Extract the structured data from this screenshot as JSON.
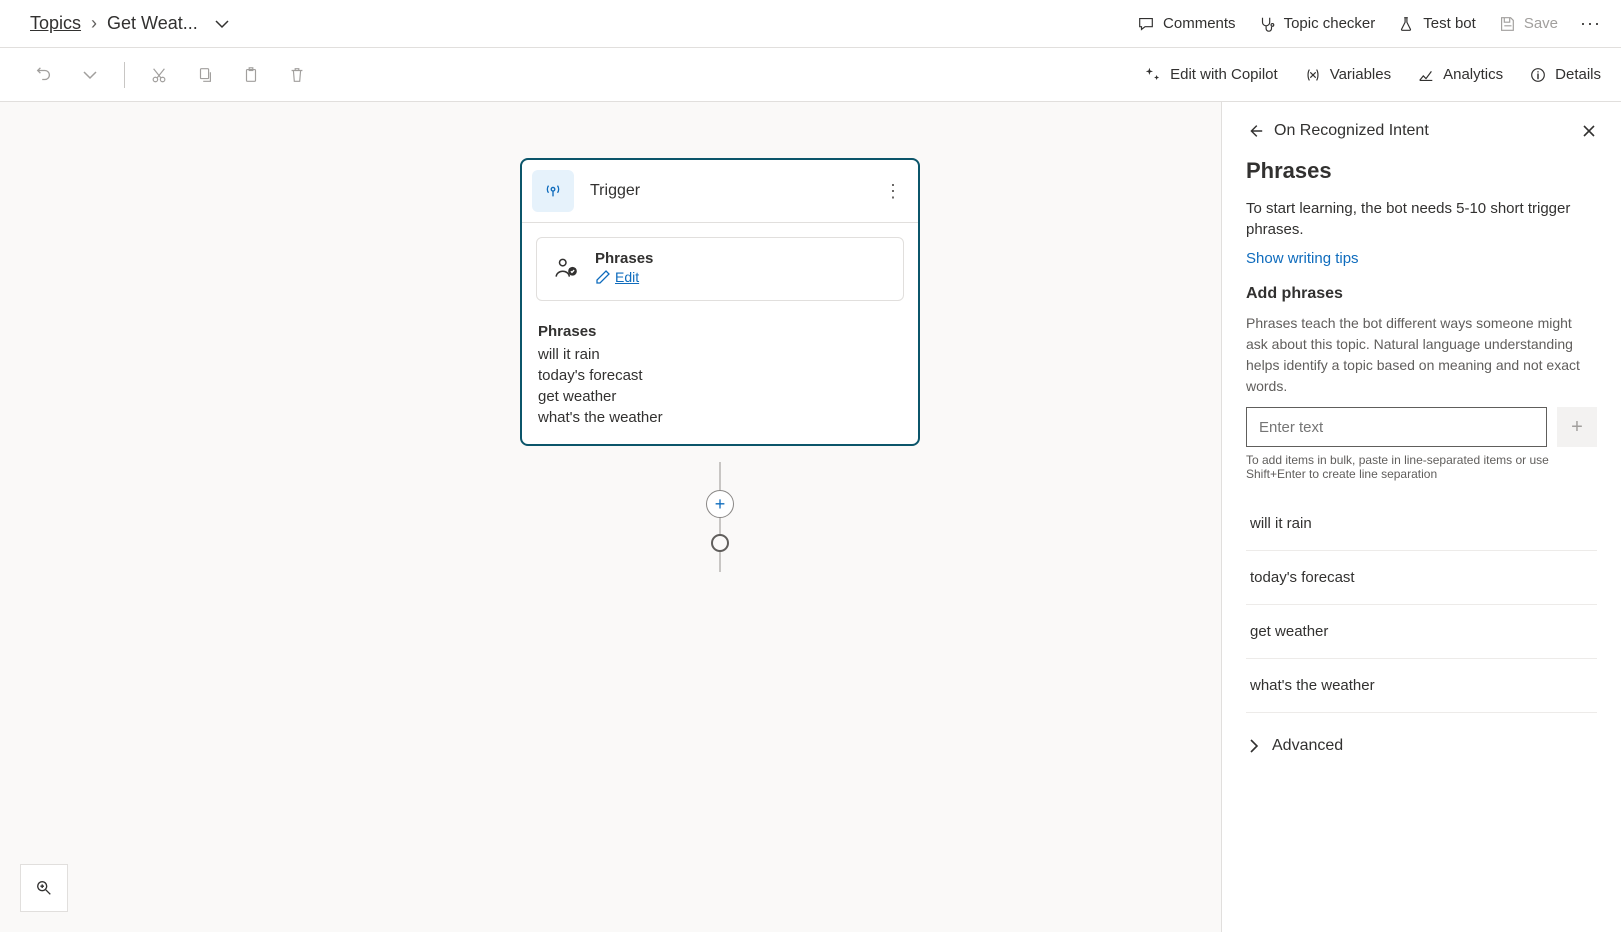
{
  "breadcrumb": {
    "root": "Topics",
    "current": "Get Weat..."
  },
  "header_actions": {
    "comments": "Comments",
    "topic_checker": "Topic checker",
    "test_bot": "Test bot",
    "save": "Save"
  },
  "toolbar": {
    "edit_with_copilot": "Edit with Copilot",
    "variables": "Variables",
    "analytics": "Analytics",
    "details": "Details"
  },
  "node": {
    "title": "Trigger",
    "section_title": "Phrases",
    "edit_label": "Edit",
    "phrases_heading": "Phrases",
    "phrases": [
      "will it rain",
      "today's forecast",
      "get weather",
      "what's the weather"
    ]
  },
  "panel": {
    "title": "On Recognized Intent",
    "heading": "Phrases",
    "desc": "To start learning, the bot needs 5-10 short trigger phrases.",
    "tips_link": "Show writing tips",
    "add_heading": "Add phrases",
    "add_desc": "Phrases teach the bot different ways someone might ask about this topic. Natural language understanding helps identify a topic based on meaning and not exact words.",
    "input_placeholder": "Enter text",
    "hint": "To add items in bulk, paste in line-separated items or use Shift+Enter to create line separation",
    "phrases": [
      "will it rain",
      "today's forecast",
      "get weather",
      "what's the weather"
    ],
    "advanced": "Advanced"
  }
}
